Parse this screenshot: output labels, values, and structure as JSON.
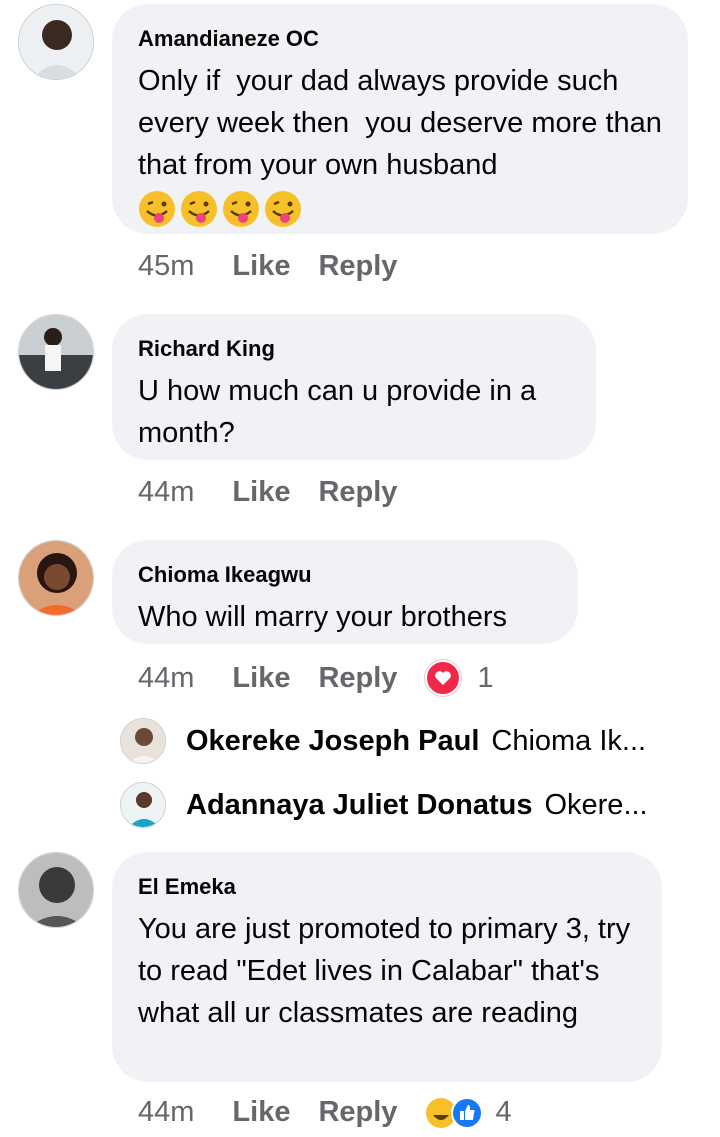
{
  "comments": [
    {
      "author": "Amandianeze OC",
      "text": "Only if  your dad always provide such every week then  you deserve more than that from your own husband",
      "emoji_count": 4,
      "time": "45m",
      "like": "Like",
      "reply": "Reply"
    },
    {
      "author": "Richard King",
      "text": "U how much can u provide in a month?",
      "time": "44m",
      "like": "Like",
      "reply": "Reply"
    },
    {
      "author": "Chioma Ikeagwu",
      "text": "Who will marry your brothers",
      "time": "44m",
      "like": "Like",
      "reply": "Reply",
      "reaction_count": "1",
      "replies": [
        {
          "author": "Okereke Joseph Paul",
          "text": "Chioma Ik..."
        },
        {
          "author": "Adannaya Juliet Donatus",
          "text": "Okere..."
        }
      ]
    },
    {
      "author": "El Emeka",
      "text": "You are just promoted to primary 3, try to read \"Edet lives in Calabar\" that's what all ur classmates are reading",
      "time": "44m",
      "like": "Like",
      "reply": "Reply",
      "reaction_count": "4"
    }
  ]
}
